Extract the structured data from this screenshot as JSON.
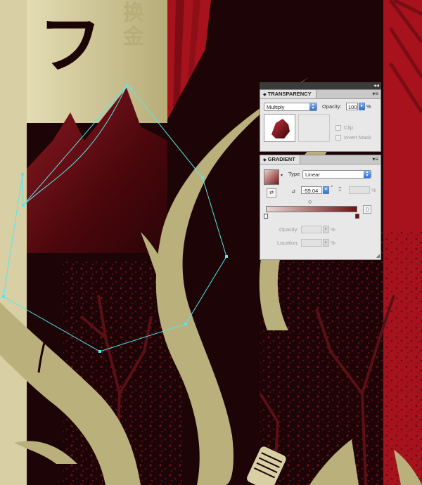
{
  "artwork": {
    "kanji_large": "フ",
    "kanji_small_1": "换",
    "kanji_small_2": "金"
  },
  "colors": {
    "background_dark": "#1d0406",
    "cream": "#d8d0a4",
    "olive_branch": "#b9b07c",
    "red": "#a8121c",
    "mountain_red": "#5e0b12",
    "selection": "#58e6ea",
    "blossom": "#5a1016"
  },
  "transparency_panel": {
    "tab_label": "TRANSPARENCY",
    "blend_mode": "Multiply",
    "opacity_label": "Opacity:",
    "opacity_value": "100",
    "opacity_unit": "%",
    "clip_label": "Clip",
    "invert_mask_label": "Invert Mask"
  },
  "gradient_panel": {
    "tab_label": "GRADIENT",
    "type_label": "Type",
    "type_value": "Linear",
    "angle_value": "-59.04",
    "angle_unit": "°",
    "aspect_unit": "%",
    "opacity_label": "Opacity:",
    "opacity_unit": "%",
    "location_label": "Location:",
    "location_unit": "%",
    "stops": [
      {
        "position": 0,
        "color": "#ffffff"
      },
      {
        "position": 100,
        "color": "#6e1111"
      }
    ],
    "gradient_start": "#e9d6d2",
    "gradient_end": "#6e1111"
  }
}
